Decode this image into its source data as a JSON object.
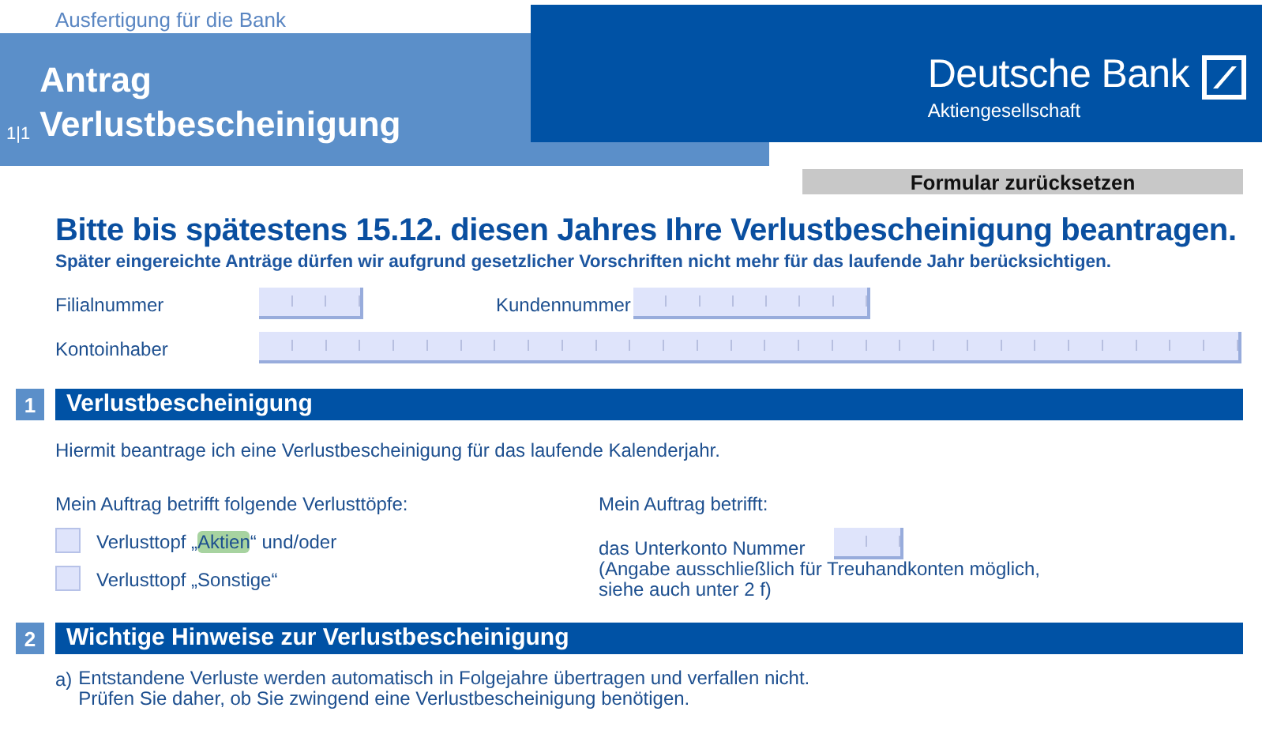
{
  "copy_label": "Ausfertigung für die Bank",
  "header": {
    "title_lines": [
      "Antrag",
      "Verlustbescheinigung"
    ],
    "page": "1|1",
    "bank_name": "Deutsche Bank",
    "bank_subtitle": "Aktiengesellschaft"
  },
  "reset_button": "Formular zurücksetzen",
  "headline": "Bitte bis spätestens 15.12. diesen Jahres Ihre Verlustbescheinigung beantragen.",
  "subline": "Später eingereichte Anträge dürfen wir aufgrund gesetzlicher Vorschriften nicht mehr für das laufende Jahr berücksichtigen.",
  "fields": [
    {
      "label": "Filialnummer"
    },
    {
      "label": "Kundennummer"
    },
    {
      "label": "Kontoinhaber"
    }
  ],
  "sections": [
    {
      "number": "1",
      "title": "Verlustbescheinigung",
      "intro": "Hiermit beantrage ich eine Verlustbescheinigung für das laufende Kalenderjahr.",
      "left_heading": "Mein Auftrag betrifft folgende Verlusttöpfe:",
      "options": [
        {
          "parts": [
            {
              "text": "Verlusttopf „",
              "highlighted": false
            },
            {
              "text": "Aktien",
              "highlighted": true
            },
            {
              "text": "“ und/oder",
              "highlighted": false
            }
          ],
          "checked": false
        },
        {
          "parts": [
            {
              "text": "Verlusttopf „Sonstige“",
              "highlighted": false
            }
          ],
          "checked": false
        }
      ],
      "right_heading": "Mein Auftrag betrifft:",
      "subaccount_label": "das Unterkonto Nummer",
      "subaccount_note": "(Angabe ausschließlich für Treuhandkonten möglich, siehe auch unter 2 f)"
    },
    {
      "number": "2",
      "title": "Wichtige Hinweise zur Verlustbescheinigung",
      "notes": [
        {
          "marker": "a)",
          "lines": [
            "Entstandene Verluste werden automatisch in Folgejahre übertragen und verfallen nicht.",
            "Prüfen Sie daher, ob Sie zwingend eine Verlustbescheinigung benötigen."
          ]
        }
      ]
    }
  ]
}
